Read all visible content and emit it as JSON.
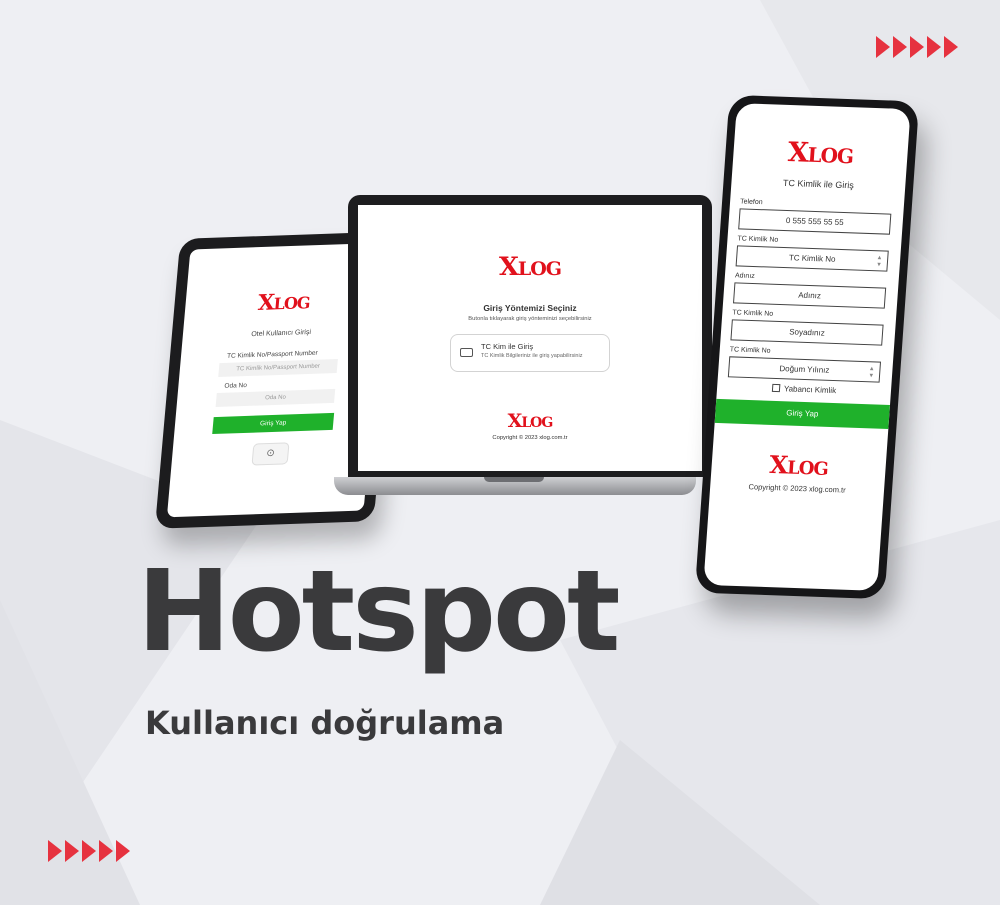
{
  "brand": {
    "logo_big": "X",
    "logo_rest": "LOG",
    "accent": "#e1111c",
    "button_green": "#1fb12b"
  },
  "headline": "Hotspot",
  "subline": "Kullanıcı doğrulama",
  "tablet": {
    "title": "Otel Kullanıcı Girişi",
    "field1_label": "TC Kimlik No/Passport Number",
    "field1_placeholder": "TC Kimlik No/Passport Number",
    "field2_label": "Oda No",
    "field2_placeholder": "Oda No",
    "button": "Giriş Yap"
  },
  "laptop": {
    "title": "Giriş Yöntemizi Seçiniz",
    "description": "Butonla tıklayarak giriş yönteminizi seçebilirsiniz",
    "card_title": "TC Kim ile Giriş",
    "card_desc": "TC Kimlik Bilgileriniz ile giriş yapabilirsiniz",
    "copyright": "Copyright © 2023 xlog.com.tr"
  },
  "phone": {
    "title": "TC Kimlik ile Giriş",
    "fields": [
      {
        "label": "Telefon",
        "value": "0 555 555 55 55"
      },
      {
        "label": "TC Kimlik No",
        "value": "TC Kimlik No"
      },
      {
        "label": "Adınız",
        "value": "Adınız"
      },
      {
        "label": "TC Kimlik No",
        "value": "Soyadınız"
      },
      {
        "label": "TC Kimlik No",
        "value": "Doğum Yılınız"
      }
    ],
    "checkbox_label": "Yabancı Kimlik",
    "button": "Giriş Yap",
    "copyright": "Copyright © 2023 xlog.com.tr"
  }
}
